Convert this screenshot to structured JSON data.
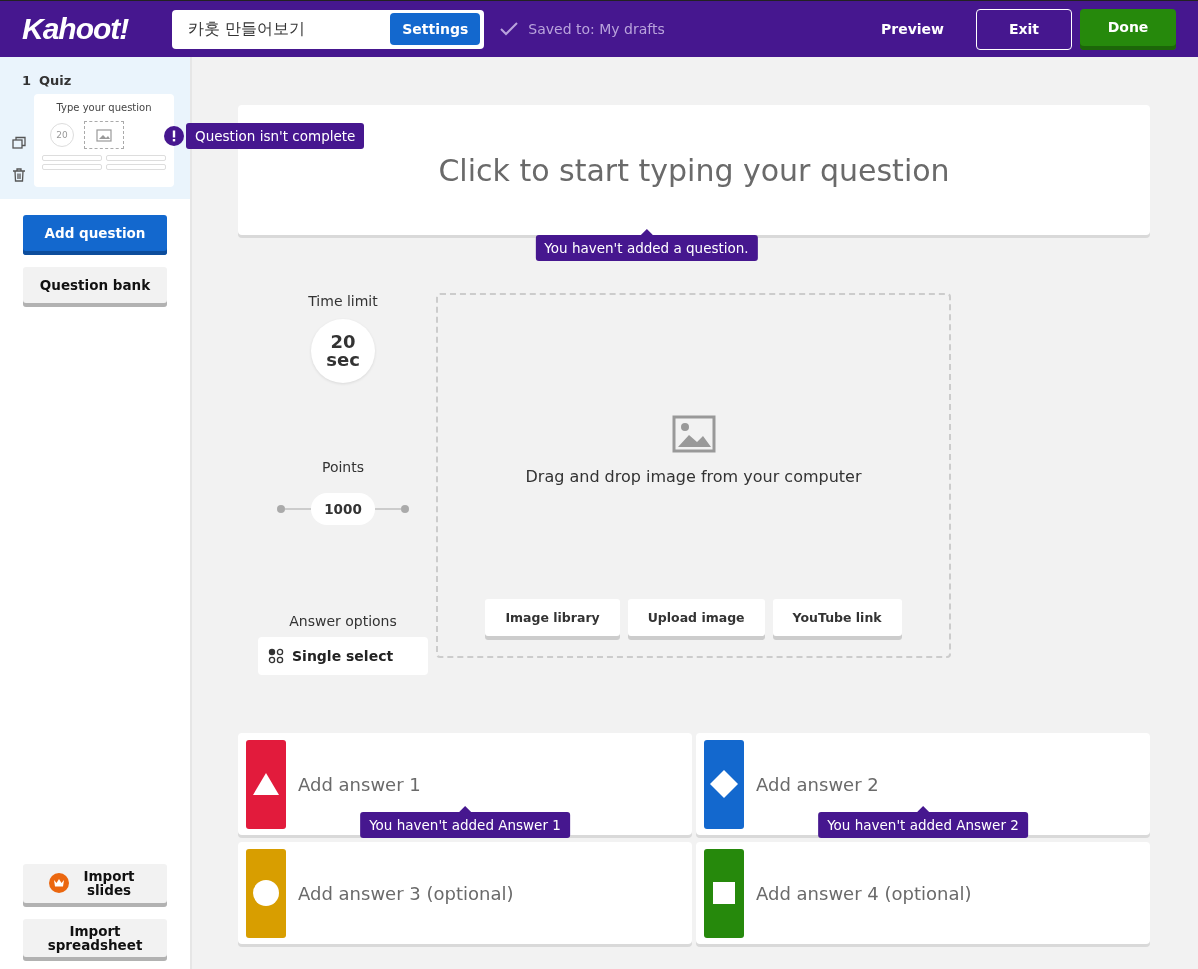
{
  "header": {
    "logo": "Kahoot!",
    "title_value": "카훗 만들어보기",
    "settings_button": "Settings",
    "saved_status": "Saved to: My drafts",
    "preview_button": "Preview",
    "exit_button": "Exit",
    "done_button": "Done"
  },
  "sidebar": {
    "slides": [
      {
        "number": "1",
        "type": "Quiz",
        "selected": true,
        "preview_text": "Type your question",
        "preview_time": "20",
        "warning": "Question isn't complete"
      }
    ],
    "add_question_button": "Add question",
    "question_bank_button": "Question bank",
    "import_slides_button": "Import slides",
    "import_spreadsheet_button": "Import spreadsheet"
  },
  "editor": {
    "question_placeholder": "Click to start typing your question",
    "question_warning": "You haven't added a question.",
    "time_limit": {
      "label": "Time limit",
      "value": "20",
      "unit": "sec"
    },
    "points": {
      "label": "Points",
      "value": "1000"
    },
    "answer_options": {
      "label": "Answer options",
      "value": "Single select"
    },
    "media": {
      "prompt": "Drag and drop image from your computer",
      "buttons": [
        "Image library",
        "Upload image",
        "YouTube link"
      ]
    },
    "answers": [
      {
        "kind": "triangle",
        "color": "#e21b3c",
        "placeholder": "Add answer 1",
        "warning": "You haven't added Answer 1"
      },
      {
        "kind": "diamond",
        "color": "#1368ce",
        "placeholder": "Add answer 2",
        "warning": "You haven't added Answer 2"
      },
      {
        "kind": "circle",
        "color": "#d89e00",
        "placeholder": "Add answer 3 (optional)"
      },
      {
        "kind": "square",
        "color": "#26890c",
        "placeholder": "Add answer 4 (optional)"
      }
    ]
  }
}
